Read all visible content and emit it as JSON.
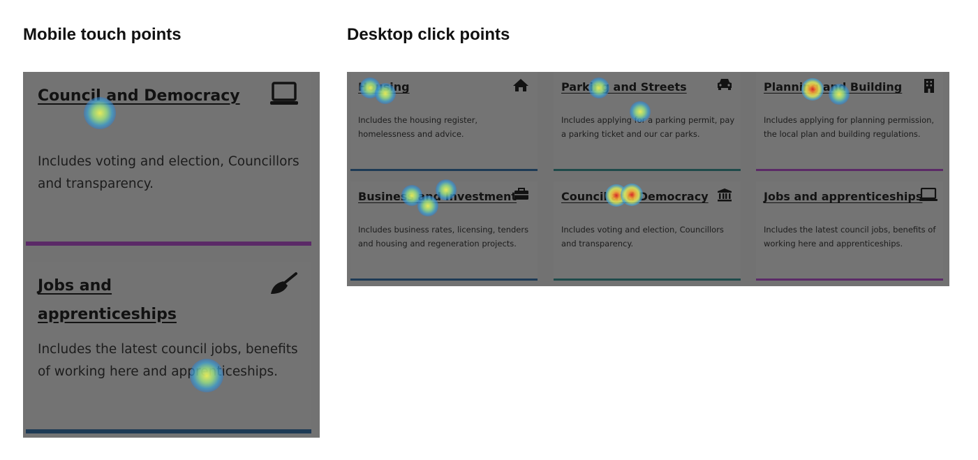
{
  "headings": {
    "mobile": "Mobile touch points",
    "desktop": "Desktop click points"
  },
  "mobile": {
    "cards": [
      {
        "title": "Council and Democracy",
        "description": "Includes voting and election, Councillors and transparency.",
        "icon": "laptop-icon",
        "bar_color": "#5b2a67"
      },
      {
        "title": "Jobs and apprenticeships",
        "description": "Includes the latest council jobs, benefits of working here and apprenticeships.",
        "icon": "broom-icon",
        "bar_color": "#1d3a55"
      }
    ]
  },
  "desktop": {
    "cards": [
      {
        "title": "Housing",
        "description": "Includes the housing register, homelessness and advice.",
        "icon": "home-icon",
        "bar_color": "#1d3a55"
      },
      {
        "title": "Parking and Streets",
        "description": "Includes applying for a parking permit, pay a parking ticket and our car parks.",
        "icon": "car-icon",
        "bar_color": "#1e4a4a"
      },
      {
        "title": "Planning and Building",
        "description": "Includes applying for planning permission, the local plan and building regulations.",
        "icon": "building-icon",
        "bar_color": "#5b2a67"
      },
      {
        "title": "Business and Investment",
        "description": "Includes business rates, licensing, tenders and housing and regeneration projects.",
        "icon": "briefcase-icon",
        "bar_color": "#1d3a55"
      },
      {
        "title": "Council and Democracy",
        "description": "Includes voting and election, Councillors and transparency.",
        "icon": "bank-icon",
        "bar_color": "#1e4a4a"
      },
      {
        "title": "Jobs and apprenticeships",
        "description": "Includes the latest council jobs, benefits of working here and apprenticeships.",
        "icon": "laptop-icon",
        "bar_color": "#5b2a67"
      }
    ]
  },
  "heatmap_colors": {
    "low": "#2d5ac8",
    "mid": "#e8ef5a",
    "high": "#e12828"
  }
}
